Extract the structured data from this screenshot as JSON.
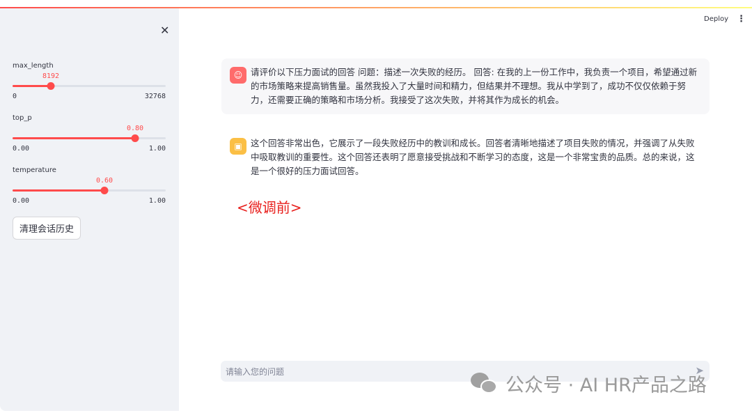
{
  "sidebar": {
    "close": "✕",
    "sliders": [
      {
        "label": "max_length",
        "value": "8192",
        "min": "0",
        "max": "32768",
        "fraction": 0.25
      },
      {
        "label": "top_p",
        "value": "0.80",
        "min": "0.00",
        "max": "1.00",
        "fraction": 0.8
      },
      {
        "label": "temperature",
        "value": "0.60",
        "min": "0.00",
        "max": "1.00",
        "fraction": 0.6
      }
    ],
    "clear_button": "清理会话历史"
  },
  "header": {
    "deploy": "Deploy",
    "menu": "⋮"
  },
  "messages": [
    {
      "role": "user",
      "text": "请评价以下压力面试的回答 问题：描述一次失败的经历。 回答: 在我的上一份工作中，我负责一个项目，希望通过新的市场策略来提高销售量。虽然我投入了大量时间和精力，但结果并不理想。我从中学到了，成功不仅仅依赖于努力，还需要正确的策略和市场分析。我接受了这次失败，并将其作为成长的机会。"
    },
    {
      "role": "assistant",
      "text": "这个回答非常出色，它展示了一段失败经历中的教训和成长。回答者清晰地描述了项目失败的情况，并强调了从失败中吸取教训的重要性。这个回答还表明了愿意接受挑战和不断学习的态度，这是一个非常宝贵的品质。总的来说，这是一个很好的压力面试回答。"
    }
  ],
  "annotation": "<微调前>",
  "chat_input": {
    "placeholder": "请输入您的问题"
  },
  "watermark": "公众号 · AI HR产品之路",
  "colors": {
    "accent": "#ff4b4b",
    "user_avatar": "#ff6b6b",
    "bot_avatar": "#fbbf45"
  }
}
